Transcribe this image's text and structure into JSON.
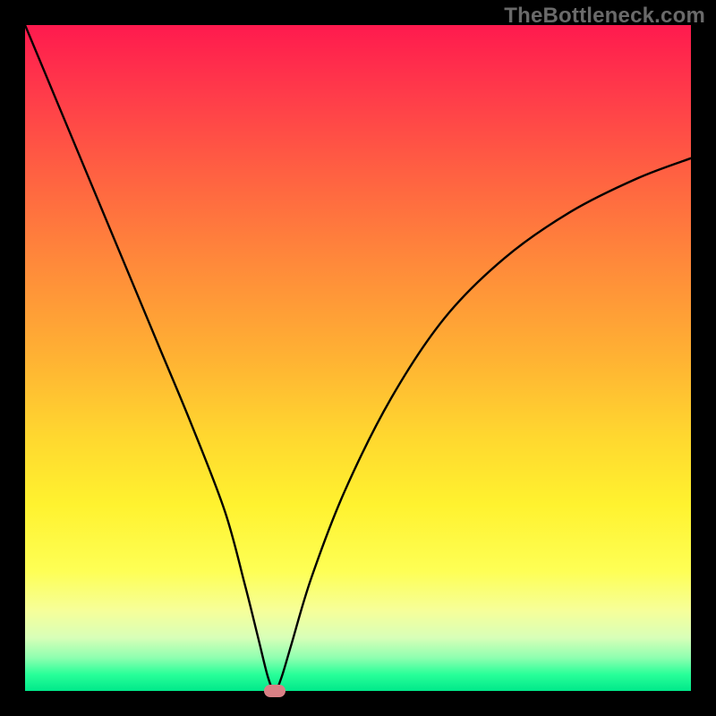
{
  "watermark": "TheBottleneck.com",
  "chart_data": {
    "type": "line",
    "title": "",
    "xlabel": "",
    "ylabel": "",
    "xlim": [
      0,
      100
    ],
    "ylim": [
      0,
      100
    ],
    "grid": false,
    "legend": false,
    "series": [
      {
        "name": "bottleneck-curve",
        "x": [
          0,
          5,
          10,
          15,
          20,
          25,
          30,
          33,
          35,
          36.5,
          37.5,
          38.5,
          40,
          43,
          48,
          55,
          63,
          72,
          82,
          92,
          100
        ],
        "y": [
          100,
          88,
          76,
          64,
          52,
          40,
          27,
          16,
          8,
          2,
          0,
          2,
          7,
          17,
          30,
          44,
          56,
          65,
          72,
          77,
          80
        ]
      }
    ],
    "marker": {
      "x": 37.5,
      "y": 0,
      "color": "#d98085"
    }
  },
  "colors": {
    "frame": "#000000",
    "gradient_top": "#ff1a4e",
    "gradient_bottom": "#00e88a",
    "curve": "#000000",
    "marker": "#d98085",
    "watermark": "#6a6a6a"
  }
}
